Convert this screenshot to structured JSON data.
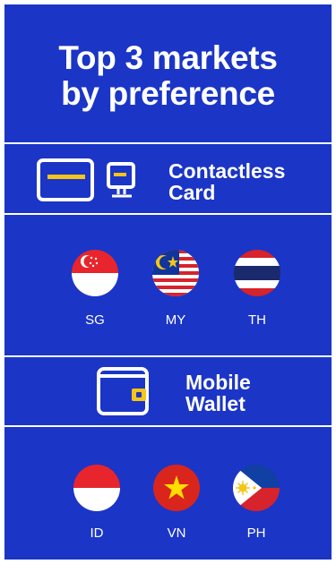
{
  "title": {
    "line1": "Top 3 markets",
    "line2": "by preference"
  },
  "categories": [
    {
      "icon": "contactless-card-and-terminal-icon",
      "label_line1": "Contactless",
      "label_line2": "Card",
      "markets": [
        {
          "code": "SG",
          "flag": "singapore-flag-icon"
        },
        {
          "code": "MY",
          "flag": "malaysia-flag-icon"
        },
        {
          "code": "TH",
          "flag": "thailand-flag-icon"
        }
      ]
    },
    {
      "icon": "mobile-wallet-icon",
      "label_line1": "Mobile",
      "label_line2": "Wallet",
      "markets": [
        {
          "code": "ID",
          "flag": "indonesia-flag-icon"
        },
        {
          "code": "VN",
          "flag": "vietnam-flag-icon"
        },
        {
          "code": "PH",
          "flag": "philippines-flag-icon"
        }
      ]
    }
  ],
  "colors": {
    "background": "#1b35c7",
    "accent": "#f5c518",
    "white": "#ffffff"
  }
}
